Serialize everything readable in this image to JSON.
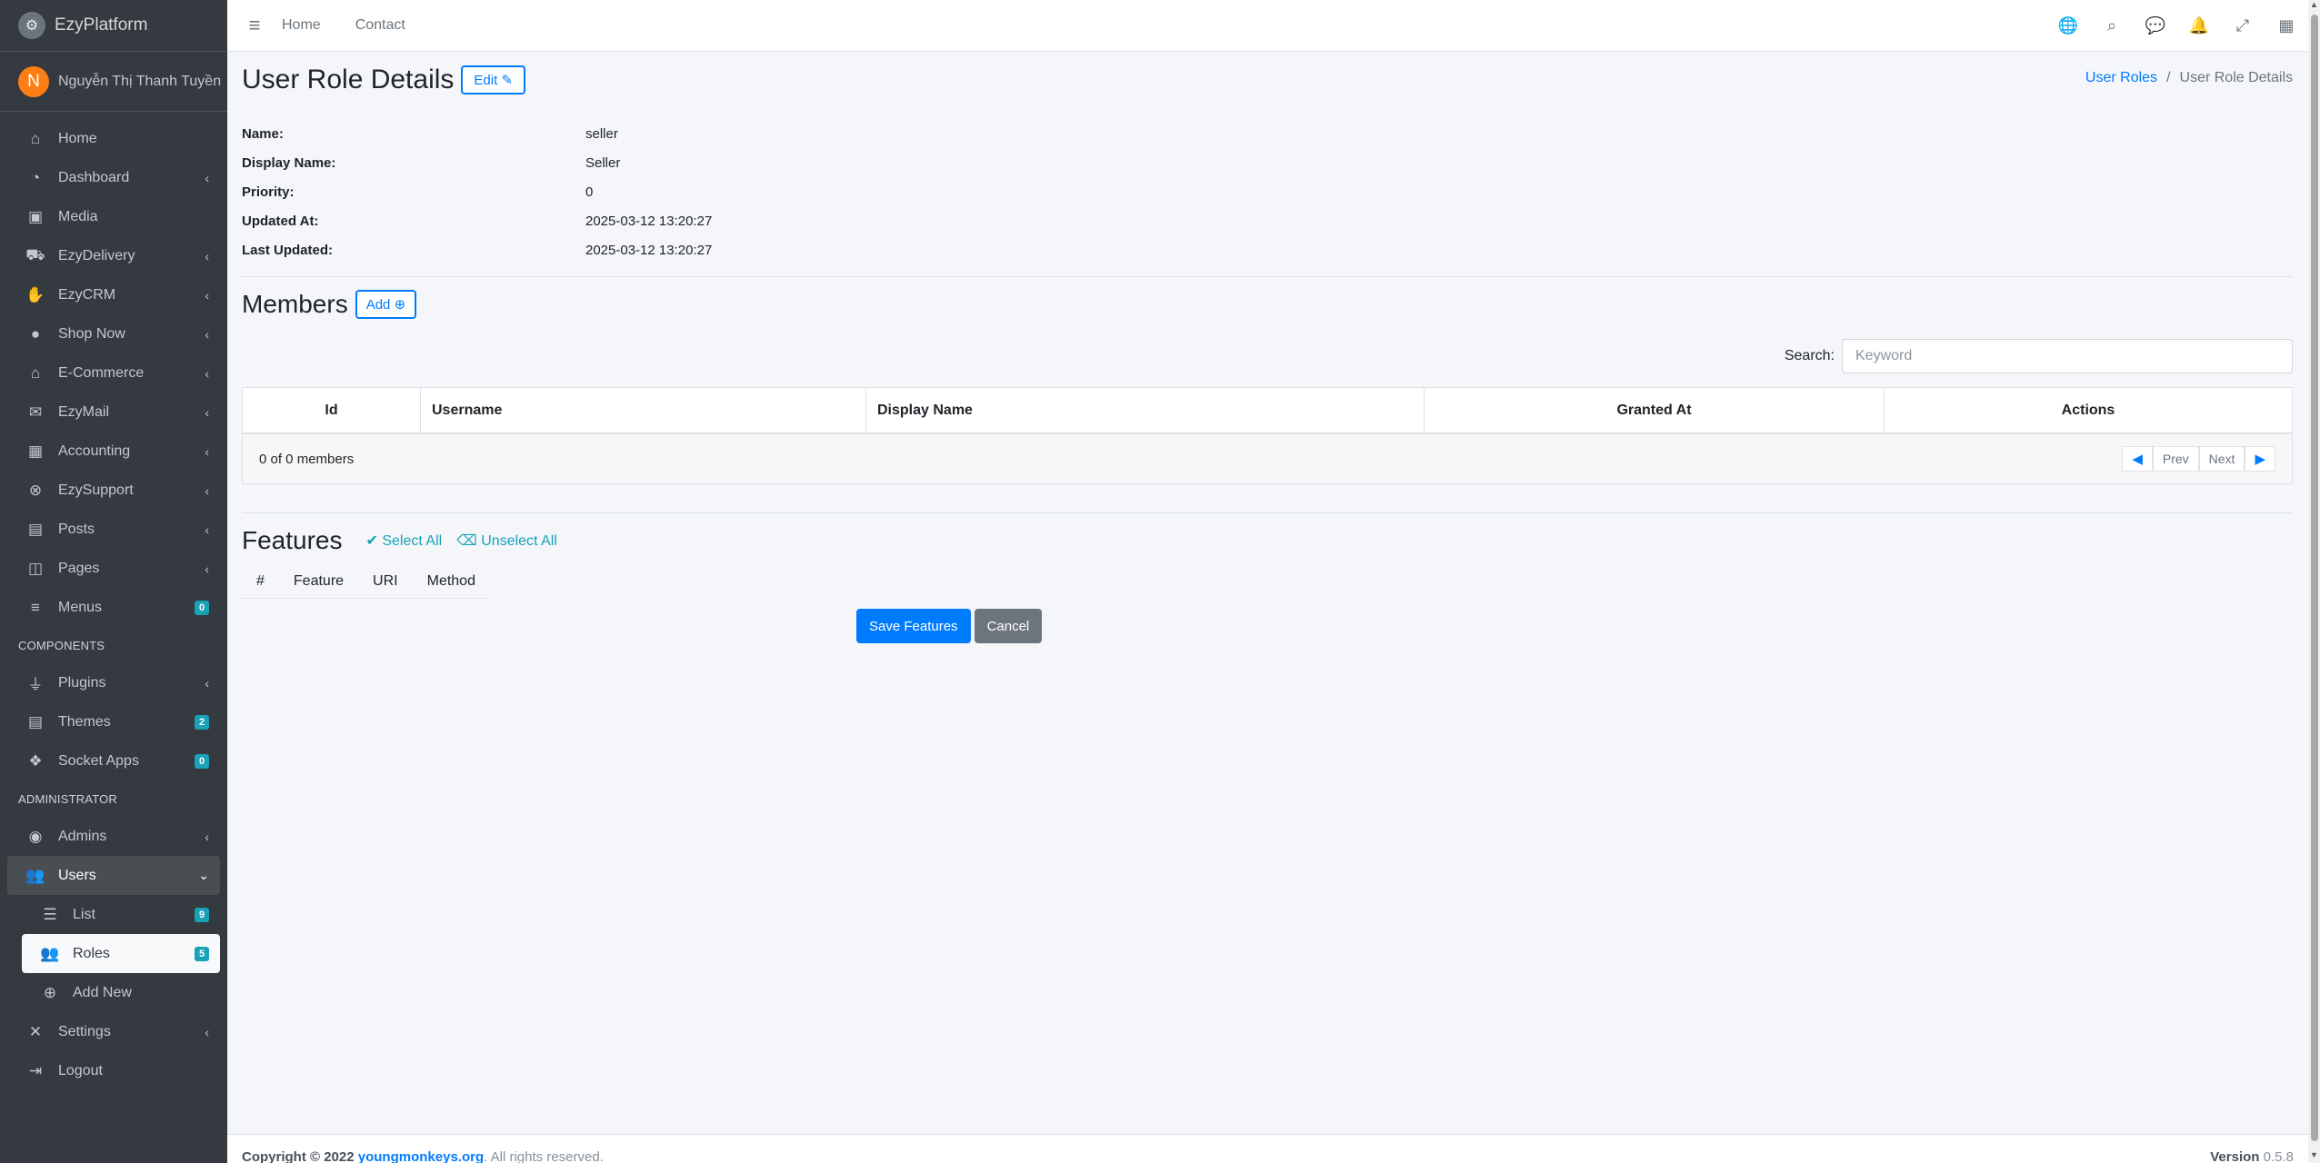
{
  "brand": {
    "name": "EzyPlatform"
  },
  "user": {
    "initial": "N",
    "name": "Nguyễn Thị Thanh Tuyền"
  },
  "sidebar": {
    "items": [
      {
        "label": "Home",
        "icon": "home-icon",
        "glyph": "⌂",
        "arrow": ""
      },
      {
        "label": "Dashboard",
        "icon": "dashboard-icon",
        "glyph": "◔",
        "arrow": "‹"
      },
      {
        "label": "Media",
        "icon": "image-icon",
        "glyph": "▣",
        "arrow": ""
      },
      {
        "label": "EzyDelivery",
        "icon": "truck-icon",
        "glyph": "⛟",
        "arrow": "‹"
      },
      {
        "label": "EzyCRM",
        "icon": "handshake-icon",
        "glyph": "✋",
        "arrow": "‹"
      },
      {
        "label": "Shop Now",
        "icon": "circle-icon",
        "glyph": "●",
        "arrow": "‹"
      },
      {
        "label": "E-Commerce",
        "icon": "basket-icon",
        "glyph": "⌂",
        "arrow": "‹"
      },
      {
        "label": "EzyMail",
        "icon": "mail-icon",
        "glyph": "✉",
        "arrow": "‹"
      },
      {
        "label": "Accounting",
        "icon": "calculator-icon",
        "glyph": "▦",
        "arrow": "‹"
      },
      {
        "label": "EzySupport",
        "icon": "lifebuoy-icon",
        "glyph": "⊗",
        "arrow": "‹"
      },
      {
        "label": "Posts",
        "icon": "newspaper-icon",
        "glyph": "▤",
        "arrow": "‹"
      },
      {
        "label": "Pages",
        "icon": "columns-icon",
        "glyph": "◫",
        "arrow": "‹"
      },
      {
        "label": "Menus",
        "icon": "bars-icon",
        "glyph": "≡",
        "badge": "0"
      }
    ],
    "components_header": "COMPONENTS",
    "components": [
      {
        "label": "Plugins",
        "icon": "plug-icon",
        "glyph": "⏚",
        "arrow": "‹"
      },
      {
        "label": "Themes",
        "icon": "newspaper-icon",
        "glyph": "▤",
        "badge": "2"
      },
      {
        "label": "Socket Apps",
        "icon": "cubes-icon",
        "glyph": "❖",
        "badge": "0"
      }
    ],
    "admin_header": "ADMINISTRATOR",
    "admin": [
      {
        "label": "Admins",
        "icon": "user-circle-icon",
        "glyph": "◉",
        "arrow": "‹"
      }
    ],
    "users": {
      "label": "Users",
      "glyph": "👥",
      "arrow": "⌄"
    },
    "users_sub": [
      {
        "label": "List",
        "icon": "list-icon",
        "glyph": "☰",
        "badge": "9"
      },
      {
        "label": "Roles",
        "icon": "users-cog-icon",
        "glyph": "👥",
        "badge": "5"
      },
      {
        "label": "Add New",
        "icon": "plus-circle-icon",
        "glyph": "⊕"
      }
    ],
    "bottom": [
      {
        "label": "Settings",
        "icon": "tools-icon",
        "glyph": "✕",
        "arrow": "‹"
      },
      {
        "label": "Logout",
        "icon": "sign-out-icon",
        "glyph": "⇥"
      }
    ]
  },
  "topbar": {
    "links": [
      "Home",
      "Contact"
    ],
    "icons": [
      {
        "name": "globe-icon",
        "glyph": "🌐"
      },
      {
        "name": "search-icon",
        "glyph": "⌕"
      },
      {
        "name": "comments-icon",
        "glyph": "💬"
      },
      {
        "name": "bell-icon",
        "glyph": "🔔"
      },
      {
        "name": "expand-icon",
        "glyph": "⤢"
      },
      {
        "name": "grid-icon",
        "glyph": "▦"
      }
    ]
  },
  "page": {
    "title": "User Role Details",
    "edit_label": "Edit",
    "breadcrumb": {
      "parent": "User Roles",
      "current": "User Role Details"
    }
  },
  "details": [
    {
      "label": "Name:",
      "value": "seller"
    },
    {
      "label": "Display Name:",
      "value": "Seller"
    },
    {
      "label": "Priority:",
      "value": "0"
    },
    {
      "label": "Updated At:",
      "value": "2025-03-12 13:20:27"
    },
    {
      "label": "Last Updated:",
      "value": "2025-03-12 13:20:27"
    }
  ],
  "members": {
    "title": "Members",
    "add_label": "Add",
    "search_label": "Search:",
    "search_placeholder": "Keyword",
    "columns": [
      "Id",
      "Username",
      "Display Name",
      "Granted At",
      "Actions"
    ],
    "summary": "0 of 0 members",
    "prev_label": "Prev",
    "next_label": "Next"
  },
  "features": {
    "title": "Features",
    "select_all": "Select All",
    "unselect_all": "Unselect All",
    "columns": [
      "#",
      "Feature",
      "URI",
      "Method"
    ],
    "save_label": "Save Features",
    "cancel_label": "Cancel"
  },
  "footer": {
    "copyright": "Copyright © 2022",
    "link": "youngmonkeys.org",
    "rights": ". All rights reserved.",
    "version_label": "Version",
    "version": "0.5.8"
  },
  "colors": {
    "accent": "#007bff",
    "sidebar": "#343a40",
    "badge": "#17a2b8",
    "avatar": "#fd7e14"
  }
}
